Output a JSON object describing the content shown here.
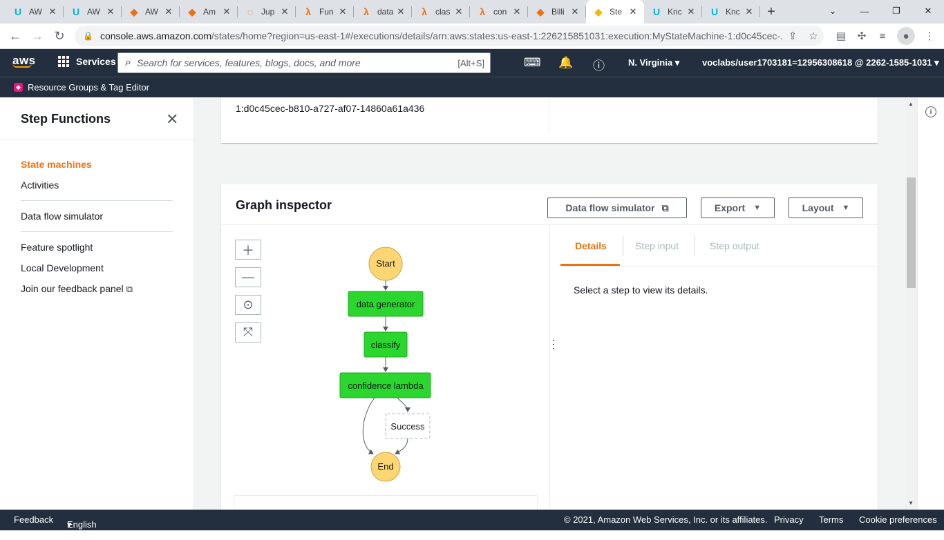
{
  "browser": {
    "tabs": [
      {
        "label": "AW",
        "icon": "udacity-icon",
        "color": "#02b3e4"
      },
      {
        "label": "AW",
        "icon": "udacity-icon",
        "color": "#02b3e4"
      },
      {
        "label": "AW",
        "icon": "aws-cube-icon",
        "color": "#ec7211"
      },
      {
        "label": "Am",
        "icon": "aws-cube-icon",
        "color": "#ec7211"
      },
      {
        "label": "Jup",
        "icon": "jupyter-icon",
        "color": "#f37726"
      },
      {
        "label": "Fun",
        "icon": "lambda-icon",
        "color": "#ec7211"
      },
      {
        "label": "data",
        "icon": "lambda-icon",
        "color": "#ec7211"
      },
      {
        "label": "clas",
        "icon": "lambda-icon",
        "color": "#ec7211"
      },
      {
        "label": "con",
        "icon": "lambda-icon",
        "color": "#ec7211"
      },
      {
        "label": "Billi",
        "icon": "aws-cube-icon",
        "color": "#ec7211"
      },
      {
        "label": "Ste",
        "icon": "aws-cube-icon",
        "color": "#f2b705",
        "active": true
      },
      {
        "label": "Knc",
        "icon": "udacity-icon",
        "color": "#02b3e4"
      },
      {
        "label": "Knc",
        "icon": "udacity-icon",
        "color": "#02b3e4"
      }
    ],
    "url_host": "console.aws.amazon.com",
    "url_path": "/states/home?region=us-east-1#/executions/details/arn:aws:states:us-east-1:226215851031:execution:MyStateMachine-1:d0c45cec-..."
  },
  "aws": {
    "logo": "aws",
    "services_label": "Services",
    "search_placeholder": "Search for services, features, blogs, docs, and more",
    "search_shortcut": "[Alt+S]",
    "region": "N. Virginia",
    "account": "voclabs/user1703181=12956308618 @ 2262-1585-1031",
    "resource_groups": "Resource Groups & Tag Editor"
  },
  "sidebar": {
    "title": "Step Functions",
    "items": {
      "state_machines": "State machines",
      "activities": "Activities",
      "data_flow_simulator": "Data flow simulator",
      "feature_spotlight": "Feature spotlight",
      "local_development": "Local Development",
      "feedback": "Join our feedback panel"
    }
  },
  "execution": {
    "arn_tail": "1:d0c45cec-b810-a727-af07-14860a61a436"
  },
  "graph": {
    "title": "Graph inspector",
    "buttons": {
      "simulator": "Data flow simulator",
      "export": "Export",
      "layout": "Layout"
    },
    "nodes": {
      "start": "Start",
      "data_generator": "data generator",
      "classify": "classify",
      "confidence_lambda": "confidence lambda",
      "success": "Success",
      "end": "End"
    },
    "colors": {
      "terminal": "#fcd672",
      "succeeded": "#2bd62e",
      "accent": "#ec7211"
    }
  },
  "details": {
    "tabs": {
      "details": "Details",
      "step_input": "Step input",
      "step_output": "Step output"
    },
    "message": "Select a step to view its details."
  },
  "footer": {
    "feedback": "Feedback",
    "language": "English (US)",
    "copyright": "© 2021, Amazon Web Services, Inc. or its affiliates.",
    "privacy": "Privacy",
    "terms": "Terms",
    "cookies": "Cookie preferences"
  }
}
